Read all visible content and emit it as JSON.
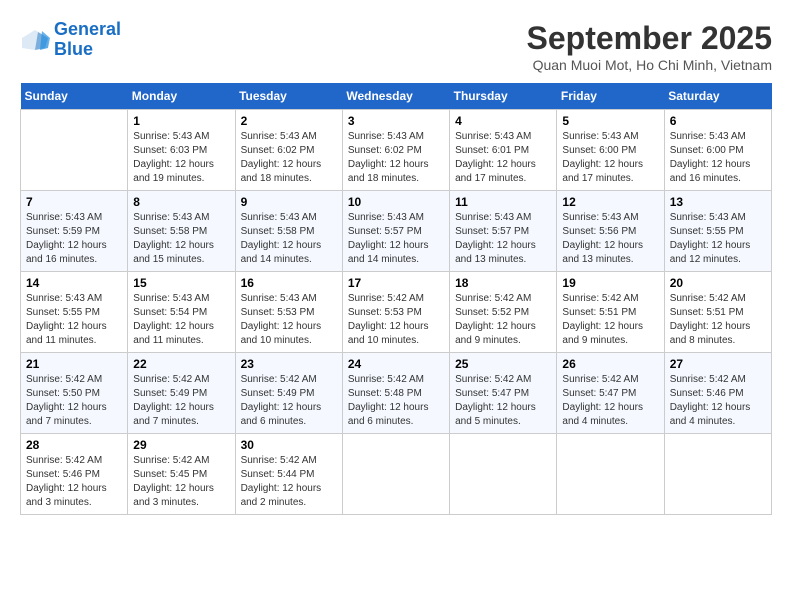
{
  "header": {
    "logo": {
      "line1": "General",
      "line2": "Blue"
    },
    "month": "September 2025",
    "location": "Quan Muoi Mot, Ho Chi Minh, Vietnam"
  },
  "days_of_week": [
    "Sunday",
    "Monday",
    "Tuesday",
    "Wednesday",
    "Thursday",
    "Friday",
    "Saturday"
  ],
  "weeks": [
    [
      {
        "day": "",
        "content": ""
      },
      {
        "day": "1",
        "content": "Sunrise: 5:43 AM\nSunset: 6:03 PM\nDaylight: 12 hours\nand 19 minutes."
      },
      {
        "day": "2",
        "content": "Sunrise: 5:43 AM\nSunset: 6:02 PM\nDaylight: 12 hours\nand 18 minutes."
      },
      {
        "day": "3",
        "content": "Sunrise: 5:43 AM\nSunset: 6:02 PM\nDaylight: 12 hours\nand 18 minutes."
      },
      {
        "day": "4",
        "content": "Sunrise: 5:43 AM\nSunset: 6:01 PM\nDaylight: 12 hours\nand 17 minutes."
      },
      {
        "day": "5",
        "content": "Sunrise: 5:43 AM\nSunset: 6:00 PM\nDaylight: 12 hours\nand 17 minutes."
      },
      {
        "day": "6",
        "content": "Sunrise: 5:43 AM\nSunset: 6:00 PM\nDaylight: 12 hours\nand 16 minutes."
      }
    ],
    [
      {
        "day": "7",
        "content": "Sunrise: 5:43 AM\nSunset: 5:59 PM\nDaylight: 12 hours\nand 16 minutes."
      },
      {
        "day": "8",
        "content": "Sunrise: 5:43 AM\nSunset: 5:58 PM\nDaylight: 12 hours\nand 15 minutes."
      },
      {
        "day": "9",
        "content": "Sunrise: 5:43 AM\nSunset: 5:58 PM\nDaylight: 12 hours\nand 14 minutes."
      },
      {
        "day": "10",
        "content": "Sunrise: 5:43 AM\nSunset: 5:57 PM\nDaylight: 12 hours\nand 14 minutes."
      },
      {
        "day": "11",
        "content": "Sunrise: 5:43 AM\nSunset: 5:57 PM\nDaylight: 12 hours\nand 13 minutes."
      },
      {
        "day": "12",
        "content": "Sunrise: 5:43 AM\nSunset: 5:56 PM\nDaylight: 12 hours\nand 13 minutes."
      },
      {
        "day": "13",
        "content": "Sunrise: 5:43 AM\nSunset: 5:55 PM\nDaylight: 12 hours\nand 12 minutes."
      }
    ],
    [
      {
        "day": "14",
        "content": "Sunrise: 5:43 AM\nSunset: 5:55 PM\nDaylight: 12 hours\nand 11 minutes."
      },
      {
        "day": "15",
        "content": "Sunrise: 5:43 AM\nSunset: 5:54 PM\nDaylight: 12 hours\nand 11 minutes."
      },
      {
        "day": "16",
        "content": "Sunrise: 5:43 AM\nSunset: 5:53 PM\nDaylight: 12 hours\nand 10 minutes."
      },
      {
        "day": "17",
        "content": "Sunrise: 5:42 AM\nSunset: 5:53 PM\nDaylight: 12 hours\nand 10 minutes."
      },
      {
        "day": "18",
        "content": "Sunrise: 5:42 AM\nSunset: 5:52 PM\nDaylight: 12 hours\nand 9 minutes."
      },
      {
        "day": "19",
        "content": "Sunrise: 5:42 AM\nSunset: 5:51 PM\nDaylight: 12 hours\nand 9 minutes."
      },
      {
        "day": "20",
        "content": "Sunrise: 5:42 AM\nSunset: 5:51 PM\nDaylight: 12 hours\nand 8 minutes."
      }
    ],
    [
      {
        "day": "21",
        "content": "Sunrise: 5:42 AM\nSunset: 5:50 PM\nDaylight: 12 hours\nand 7 minutes."
      },
      {
        "day": "22",
        "content": "Sunrise: 5:42 AM\nSunset: 5:49 PM\nDaylight: 12 hours\nand 7 minutes."
      },
      {
        "day": "23",
        "content": "Sunrise: 5:42 AM\nSunset: 5:49 PM\nDaylight: 12 hours\nand 6 minutes."
      },
      {
        "day": "24",
        "content": "Sunrise: 5:42 AM\nSunset: 5:48 PM\nDaylight: 12 hours\nand 6 minutes."
      },
      {
        "day": "25",
        "content": "Sunrise: 5:42 AM\nSunset: 5:47 PM\nDaylight: 12 hours\nand 5 minutes."
      },
      {
        "day": "26",
        "content": "Sunrise: 5:42 AM\nSunset: 5:47 PM\nDaylight: 12 hours\nand 4 minutes."
      },
      {
        "day": "27",
        "content": "Sunrise: 5:42 AM\nSunset: 5:46 PM\nDaylight: 12 hours\nand 4 minutes."
      }
    ],
    [
      {
        "day": "28",
        "content": "Sunrise: 5:42 AM\nSunset: 5:46 PM\nDaylight: 12 hours\nand 3 minutes."
      },
      {
        "day": "29",
        "content": "Sunrise: 5:42 AM\nSunset: 5:45 PM\nDaylight: 12 hours\nand 3 minutes."
      },
      {
        "day": "30",
        "content": "Sunrise: 5:42 AM\nSunset: 5:44 PM\nDaylight: 12 hours\nand 2 minutes."
      },
      {
        "day": "",
        "content": ""
      },
      {
        "day": "",
        "content": ""
      },
      {
        "day": "",
        "content": ""
      },
      {
        "day": "",
        "content": ""
      }
    ]
  ]
}
